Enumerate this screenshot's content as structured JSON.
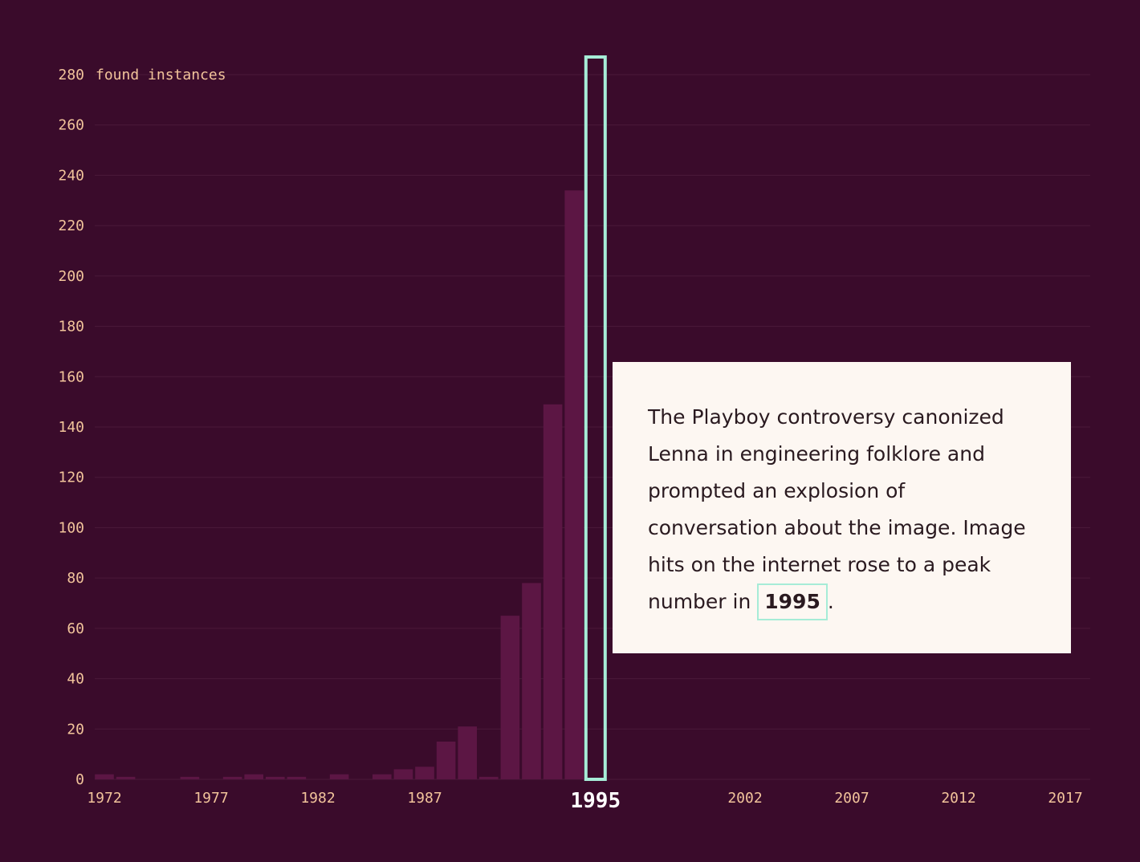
{
  "chart_data": {
    "type": "bar",
    "ylabel": "found instances",
    "ylim": [
      0,
      280
    ],
    "yticks": [
      0,
      20,
      40,
      60,
      80,
      100,
      120,
      140,
      160,
      180,
      200,
      220,
      240,
      260,
      280
    ],
    "x": [
      1972,
      1973,
      1974,
      1975,
      1976,
      1977,
      1978,
      1979,
      1980,
      1981,
      1982,
      1983,
      1984,
      1985,
      1986,
      1987,
      1988,
      1989,
      1990,
      1991,
      1992,
      1993,
      1994,
      1995
    ],
    "values": [
      2,
      1,
      0,
      0,
      1,
      0,
      1,
      2,
      1,
      1,
      0,
      2,
      0,
      2,
      4,
      5,
      15,
      21,
      1,
      65,
      78,
      149,
      234,
      0
    ],
    "xtick_labels": [
      "1972",
      "1977",
      "1982",
      "1987",
      "2002",
      "2007",
      "2012",
      "2017"
    ],
    "highlight": {
      "year": "1995",
      "color": "#a6ecd7"
    },
    "colors": {
      "background": "#3a0b2b",
      "bar": "#5c1644",
      "label": "#f2c49b",
      "gridline": "#4a1a3a"
    }
  },
  "annotation": {
    "text": "The Playboy controversy canonized Lenna in engineering folklore and prompted an explosion of conversation about the image. Image hits on the internet rose to a peak number in ",
    "year": "1995",
    "suffix": "."
  }
}
